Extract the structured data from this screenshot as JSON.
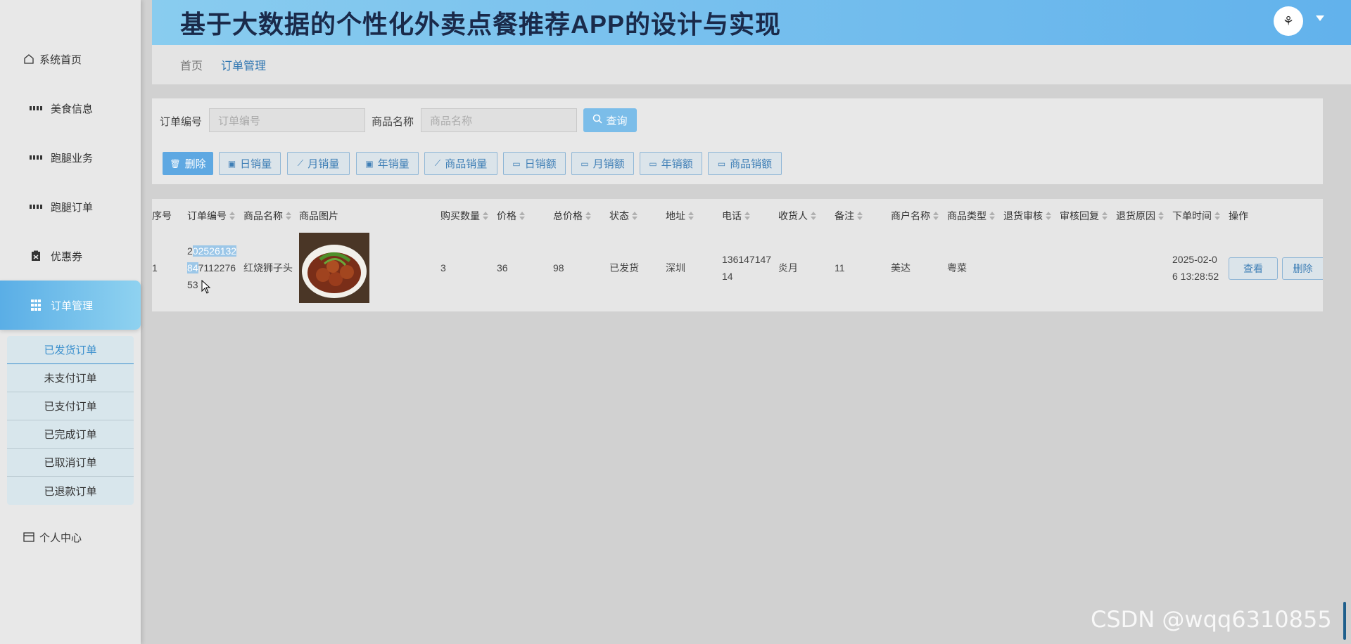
{
  "sidebar": {
    "home": "系统首页",
    "items": [
      {
        "label": "美食信息"
      },
      {
        "label": "跑腿业务"
      },
      {
        "label": "跑腿订单"
      },
      {
        "label": "优惠券"
      },
      {
        "label": "订单管理"
      }
    ],
    "submenu": [
      "已发货订单",
      "未支付订单",
      "已支付订单",
      "已完成订单",
      "已取消订单",
      "已退款订单"
    ],
    "profile": "个人中心"
  },
  "header": {
    "title": "基于大数据的个性化外卖点餐推荐APP的设计与实现",
    "avatar_glyph": "⚘"
  },
  "breadcrumb": {
    "home": "首页",
    "current": "订单管理"
  },
  "search": {
    "order_no_label": "订单编号",
    "order_no_placeholder": "订单编号",
    "product_label": "商品名称",
    "product_placeholder": "商品名称",
    "query_label": "查询"
  },
  "toolbar": {
    "delete": "删除",
    "daily_qty": "日销量",
    "monthly_qty": "月销量",
    "yearly_qty": "年销量",
    "product_qty": "商品销量",
    "daily_amt": "日销额",
    "monthly_amt": "月销额",
    "yearly_amt": "年销额",
    "product_amt": "商品销额"
  },
  "table": {
    "headers": {
      "index": "序号",
      "order_no": "订单编号",
      "product": "商品名称",
      "image": "商品图片",
      "qty": "购买数量",
      "price": "价格",
      "total": "总价格",
      "status": "状态",
      "address": "地址",
      "phone": "电话",
      "receiver": "收货人",
      "remark": "备注",
      "merchant": "商户名称",
      "category": "商品类型",
      "return_review": "退货审核",
      "review_reply": "审核回复",
      "return_reason": "退货原因",
      "order_time": "下单时间",
      "action": "操作"
    },
    "row": {
      "index": "1",
      "order_no_1a": "2",
      "order_no_1b": "02526132",
      "order_no_2a": "84",
      "order_no_2b": "7112276",
      "order_no_3": "53",
      "product": "红烧狮子头",
      "qty": "3",
      "price": "36",
      "total": "98",
      "status": "已发货",
      "address": "深圳",
      "phone_1": "136147147",
      "phone_2": "14",
      "receiver": "炎月",
      "remark": "11",
      "merchant": "美达",
      "category": "粤菜",
      "order_time_1": "2025-02-0",
      "order_time_2": "6 13:28:52",
      "view_label": "查看",
      "delete_label": "删除"
    }
  },
  "watermark": "CSDN @wqq6310855"
}
